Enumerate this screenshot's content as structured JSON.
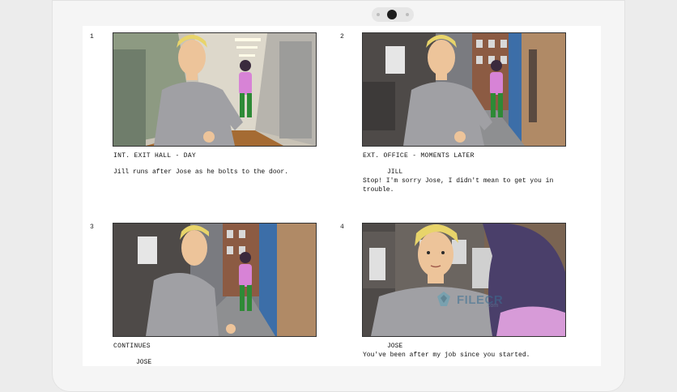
{
  "panels": [
    {
      "number": "1",
      "scene": "INT. EXIT HALL - DAY",
      "action": "Jill runs after Jose as he bolts to the door.",
      "character": "",
      "dialogue": ""
    },
    {
      "number": "2",
      "scene": "EXT. OFFICE - MOMENTS LATER",
      "action": "",
      "character": "JILL",
      "dialogue": "Stop! I'm sorry Jose, I didn't mean to get you in trouble."
    },
    {
      "number": "3",
      "scene": "CONTINUES",
      "action": "",
      "character": "JOSE",
      "dialogue": ""
    },
    {
      "number": "4",
      "scene": "",
      "action": "",
      "character": "JOSE",
      "dialogue": "You've been after my job since you started."
    }
  ],
  "watermark": {
    "text": "FILECR",
    "sub": ".com"
  },
  "colors": {
    "page": "#ffffff",
    "device": "#f5f5f5",
    "frame_border": "#333333"
  }
}
